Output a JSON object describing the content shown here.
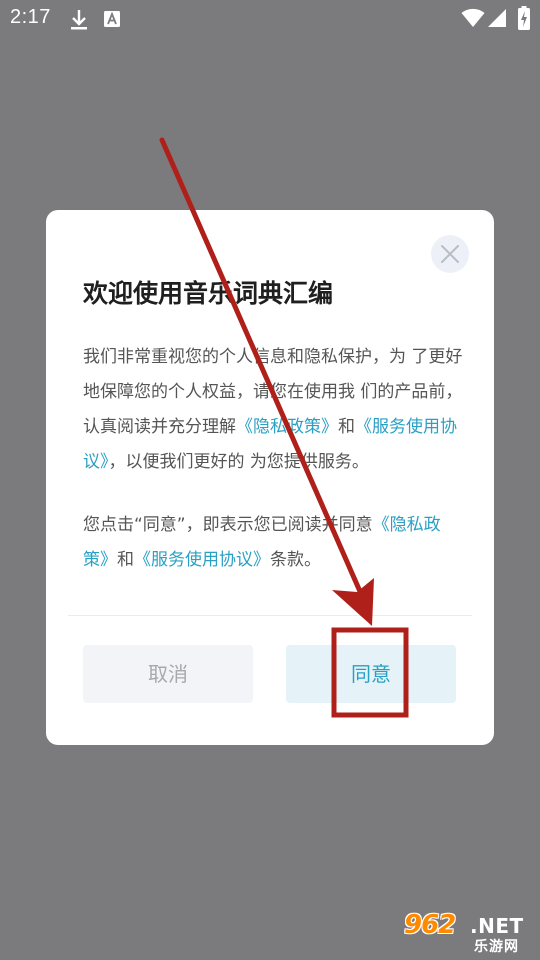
{
  "status_bar": {
    "time": "2:17",
    "icons": [
      "download-icon",
      "font-notification-icon",
      "wifi-icon",
      "cellular-signal-icon",
      "battery-charging-icon"
    ]
  },
  "dialog": {
    "close_icon": "close-icon",
    "title": "欢迎使用音乐词典汇编",
    "paragraph1": {
      "before_link1": "我们非常重视您的个人信息和隐私保护，为 了更好地保障您的个人权益，请您在使用我 们的产品前，认真阅读并充分理解",
      "link1": "《隐私政策》",
      "between": "和",
      "link2": "《服务使用协议》",
      "after": "，以便我们更好的 为您提供服务。"
    },
    "paragraph2": {
      "before_link1": "您点击“同意”，即表示您已阅读并同意",
      "link1": "《隐私政策》",
      "between": "和",
      "link2": "《服务使用协议》",
      "after": "条款。"
    },
    "cancel_label": "取消",
    "agree_label": "同意"
  },
  "watermark": {
    "digits": "962",
    "suffix": ".NET",
    "site": "乐游网"
  },
  "colors": {
    "overlay": "#7b7b7d",
    "link": "#2aa0c4",
    "annotation": "#b0201a",
    "watermark_orange": "#ff8a00"
  }
}
